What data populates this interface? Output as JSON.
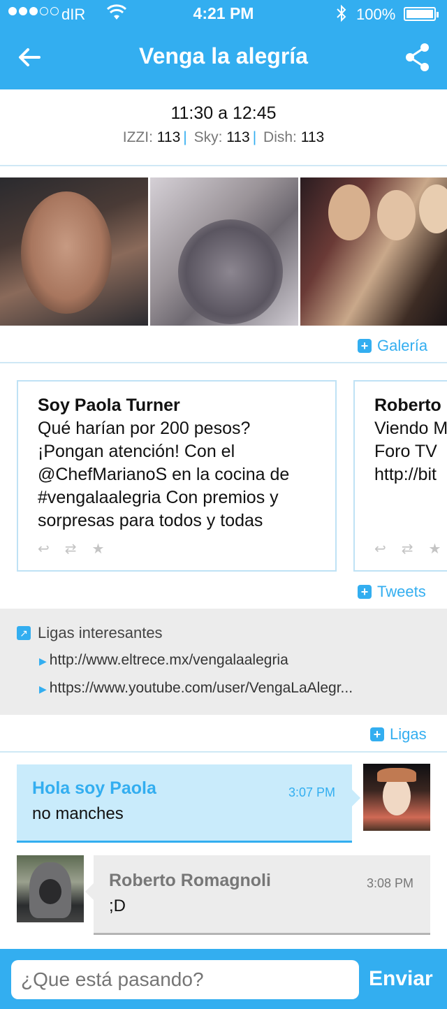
{
  "status_bar": {
    "carrier": "dIR",
    "time": "4:21 PM",
    "battery": "100%",
    "signal_bars_filled": 3,
    "signal_bars_total": 5
  },
  "nav": {
    "title": "Venga la alegría",
    "back_icon": "back-arrow-icon",
    "share_icon": "share-icon"
  },
  "schedule": {
    "time": "11:30 a 12:45",
    "channels": [
      {
        "name": "IZZI:",
        "number": "113"
      },
      {
        "name": "Sky:",
        "number": "113"
      },
      {
        "name": "Dish:",
        "number": "113"
      }
    ]
  },
  "gallery": {
    "more_label": "Galería"
  },
  "tweets": {
    "items": [
      {
        "author": "Soy Paola Turner",
        "text": "Qué harían por 200 pesos? ¡Pongan atención! Con el @ChefMarianoS en la cocina de #vengalaalegria Con premios y sorpresas para todos y todas"
      },
      {
        "author": "Roberto",
        "text": "Viendo M Foro TV http://bit"
      }
    ],
    "more_label": "Tweets"
  },
  "links": {
    "header": "Ligas interesantes",
    "items": [
      "http://www.eltrece.mx/vengalaalegria",
      "https://www.youtube.com/user/VengaLaAlegr..."
    ],
    "more_label": "Ligas"
  },
  "chat": {
    "messages": [
      {
        "name": "Hola soy Paola",
        "time": "3:07 PM",
        "text": "no manches",
        "side": "right"
      },
      {
        "name": "Roberto Romagnoli",
        "time": "3:08 PM",
        "text": ";D",
        "side": "left"
      }
    ]
  },
  "composer": {
    "placeholder": "¿Que está pasando?",
    "send_label": "Enviar"
  },
  "colors": {
    "accent": "#33aef0",
    "bubble_me": "#c9ebfb",
    "bubble_other": "#ececec"
  }
}
